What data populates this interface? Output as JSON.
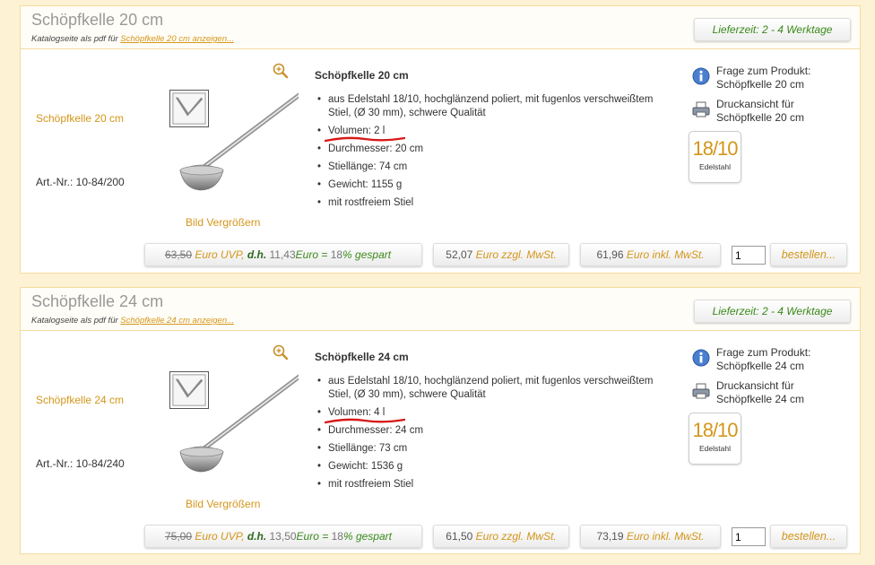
{
  "products": [
    {
      "title": "Schöpfkelle 20 cm",
      "catalog_text": "Katalogseite als pdf für ",
      "catalog_link": "Schöpfkelle 20 cm anzeigen...",
      "delivery": "Lieferzeit: 2 - 4 Werktage",
      "side_name": "Schöpfkelle 20 cm",
      "art_nr": "Art.-Nr.: 10-84/200",
      "enlarge": "Bild Vergrößern",
      "heading": "Schöpfkelle 20 cm",
      "features": [
        "aus Edelstahl 18/10, hochglänzend poliert, mit fugenlos verschweißtem Stiel, (Ø 30 mm), schwere Qualität",
        "Volumen: 2 l",
        "Durchmesser: 20 cm",
        "Stiellänge: 74 cm",
        "Gewicht: 1155 g",
        "mit rostfreiem Stiel"
      ],
      "question": "Frage zum Produkt: Schöpfkelle 20 cm",
      "print": "Druckansicht für Schöpfkelle 20 cm",
      "badge_big": "18/10",
      "badge_small": "Edelstahl",
      "uvp": "63,50",
      "uvp_label": " Euro UVP, ",
      "dh": "d.h.",
      "dh_value": " 11,43",
      "euro_eq": "Euro = ",
      "percent": " 18",
      "saved": "% gespart",
      "net_value": "52,07",
      "net_label": " Euro zzgl. MwSt.",
      "gross_value": "61,96",
      "gross_label": " Euro inkl. MwSt.",
      "qty": "1",
      "order": "bestellen..."
    },
    {
      "title": "Schöpfkelle 24 cm",
      "catalog_text": "Katalogseite als pdf für ",
      "catalog_link": "Schöpfkelle 24 cm anzeigen...",
      "delivery": "Lieferzeit: 2 - 4 Werktage",
      "side_name": "Schöpfkelle 24 cm",
      "art_nr": "Art.-Nr.: 10-84/240",
      "enlarge": "Bild Vergrößern",
      "heading": "Schöpfkelle 24 cm",
      "features": [
        "aus Edelstahl 18/10, hochglänzend poliert, mit fugenlos verschweißtem Stiel, (Ø 30 mm), schwere Qualität",
        "Volumen: 4 l",
        "Durchmesser: 24 cm",
        "Stiellänge: 73 cm",
        "Gewicht: 1536 g",
        "mit rostfreiem Stiel"
      ],
      "question": "Frage zum Produkt: Schöpfkelle 24 cm",
      "print": "Druckansicht für Schöpfkelle 24 cm",
      "badge_big": "18/10",
      "badge_small": "Edelstahl",
      "uvp": "75,00",
      "uvp_label": " Euro UVP, ",
      "dh": "d.h.",
      "dh_value": " 13,50",
      "euro_eq": "Euro = ",
      "percent": " 18",
      "saved": "% gespart",
      "net_value": "61,50",
      "net_label": " Euro zzgl. MwSt.",
      "gross_value": "73,19",
      "gross_label": " Euro inkl. MwSt.",
      "qty": "1",
      "order": "bestellen..."
    }
  ],
  "colors": {
    "accent": "#d4961a",
    "green": "#3a8a1a",
    "background": "#fdf2d3",
    "annotation": "#d81818"
  }
}
